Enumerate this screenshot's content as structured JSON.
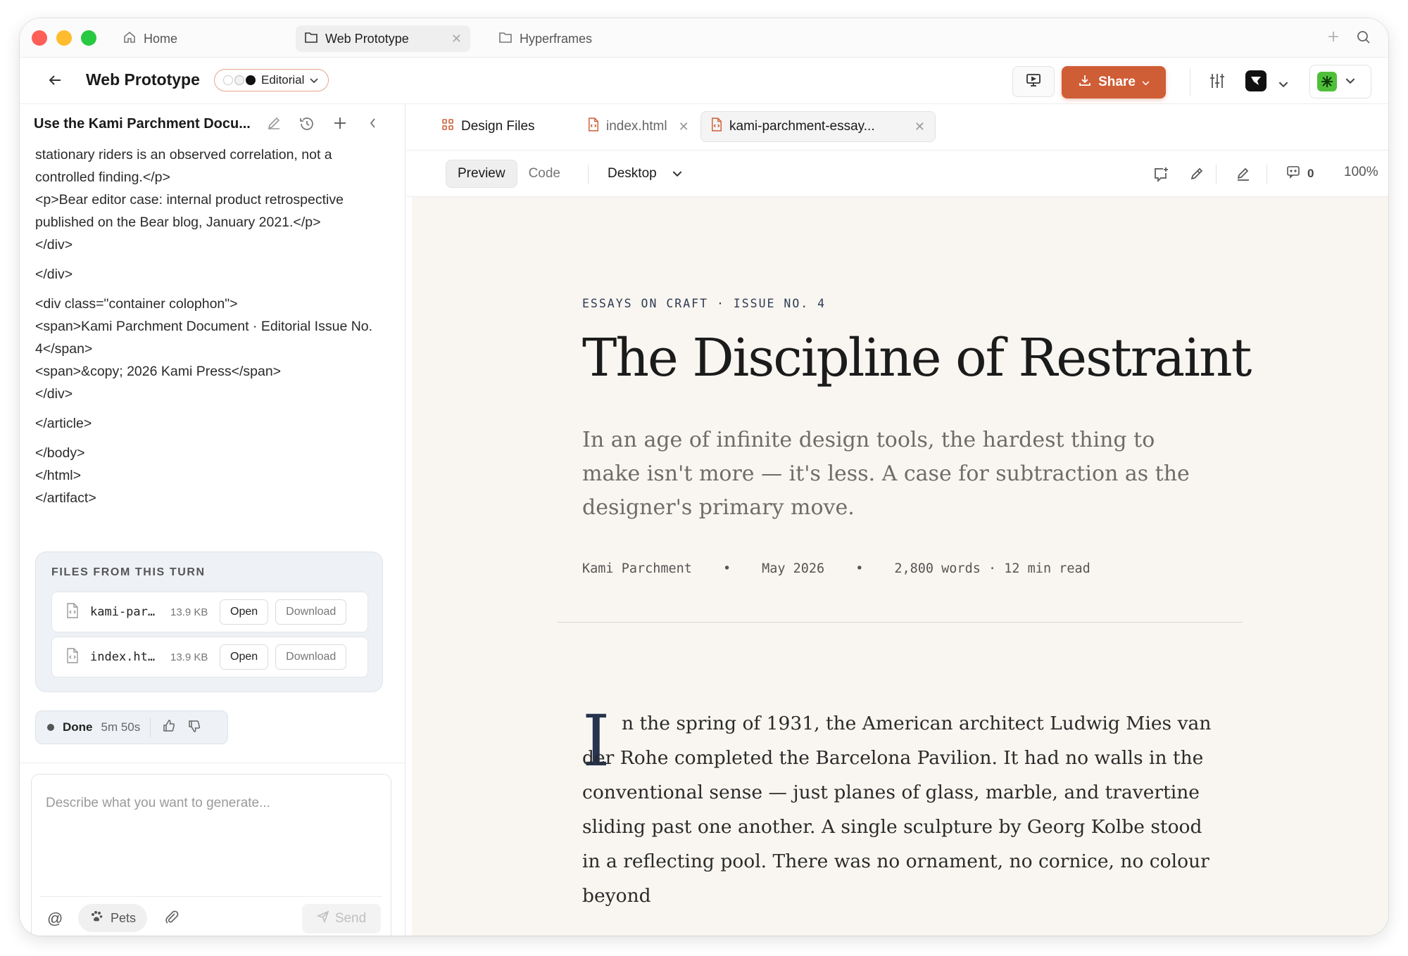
{
  "window_tabs": [
    {
      "label": "Home"
    },
    {
      "label": "Web Prototype"
    },
    {
      "label": "Hyperframes"
    }
  ],
  "toolbar": {
    "title": "Web Prototype",
    "style_label": "Editorial",
    "share_label": "Share"
  },
  "chat": {
    "title": "Use the Kami Parchment Docu...",
    "code_lines": [
      "stationary riders is an observed correlation, not a controlled finding.</p>\n<p>Bear editor case: internal product retrospective published on the Bear blog, January 2021.</p>\n</div>",
      "</div>",
      "<div class=\"container colophon\">\n<span>Kami Parchment Document · Editorial Issue No. 4</span>\n<span>&copy; 2026 Kami Press</span>\n</div>",
      "</article>",
      "</body>\n</html>\n</artifact>"
    ],
    "files_label": "FILES FROM THIS TURN",
    "files": [
      {
        "name": "kami-par…",
        "size": "13.9 KB",
        "open": "Open",
        "download": "Download"
      },
      {
        "name": "index.ht…",
        "size": "13.9 KB",
        "open": "Open",
        "download": "Download"
      }
    ],
    "status": {
      "label": "Done",
      "time": "5m 50s"
    },
    "composer": {
      "placeholder": "Describe what you want to generate...",
      "at": "@",
      "pets": "Pets",
      "send": "Send"
    }
  },
  "file_tabs": [
    {
      "label": "Design Files"
    },
    {
      "label": "index.html"
    },
    {
      "label": "kami-parchment-essay..."
    }
  ],
  "view_bar": {
    "preview": "Preview",
    "code": "Code",
    "device": "Desktop",
    "comments_count": "0",
    "zoom": "100%"
  },
  "article": {
    "eyebrow": "ESSAYS ON CRAFT · ISSUE NO. 4",
    "headline": "The Discipline of Restraint",
    "dek": "In an age of infinite design tools, the hardest thing to make isn't more — it's less. A case for subtraction as the designer's primary move.",
    "author": "Kami Parchment",
    "bullet": "•",
    "date": "May 2026",
    "length": "2,800 words · 12 min read",
    "dropcap": "I",
    "body": "n the spring of 1931, the American architect Ludwig Mies van der Rohe completed the Barcelona Pavilion. It had no walls in the conventional sense — just planes of glass, marble, and travertine sliding past one another. A single sculpture by Georg Kolbe stood in a reflecting pool. There was no ornament, no cornice, no colour beyond"
  },
  "colors": {
    "accent": "#cf5d35",
    "dropcap": "#26344f",
    "preview_bg": "#f9f6f1"
  }
}
